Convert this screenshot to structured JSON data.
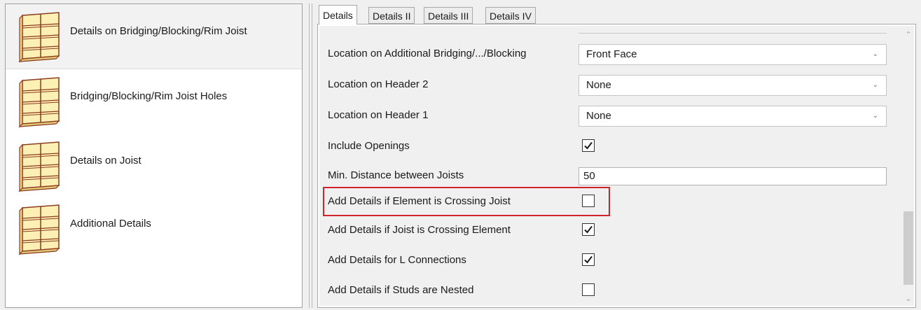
{
  "categories": [
    {
      "label": "Details on Bridging/Blocking/Rim Joist",
      "icon": "joist-frame-icon",
      "selected": true
    },
    {
      "label": "Bridging/Blocking/Rim Joist Holes",
      "icon": "joist-frame-icon",
      "selected": false
    },
    {
      "label": "Details on Joist",
      "icon": "joist-frame-icon",
      "selected": false
    },
    {
      "label": "Additional Details",
      "icon": "joist-frame-icon",
      "selected": false
    }
  ],
  "tabs": [
    {
      "label": "Details",
      "active": true
    },
    {
      "label": "Details II",
      "active": false
    },
    {
      "label": "Details III",
      "active": false
    },
    {
      "label": "Details IV",
      "active": false
    }
  ],
  "properties": [
    {
      "label": "Location on Additional Bridging/.../Blocking",
      "type": "combo",
      "value": "Front Face"
    },
    {
      "label": "Location on Header 2",
      "type": "combo",
      "value": "None"
    },
    {
      "label": "Location on Header 1",
      "type": "combo",
      "value": "None"
    },
    {
      "label": "Include Openings",
      "type": "checkbox",
      "checked": true
    },
    {
      "label": "Min. Distance between Joists",
      "type": "text",
      "value": "50"
    },
    {
      "label": "Add Details if Element is Crossing Joist",
      "type": "checkbox",
      "checked": false,
      "highlighted": true
    },
    {
      "label": "Add Details if Joist is Crossing Element",
      "type": "checkbox",
      "checked": true
    },
    {
      "label": "Add Details for L Connections",
      "type": "checkbox",
      "checked": true
    },
    {
      "label": "Add Details if Studs are Nested",
      "type": "checkbox",
      "checked": false
    }
  ],
  "colors": {
    "highlight": "#d2232a",
    "icon_wood": "#fdf0b4",
    "icon_edge": "#8b3a1e"
  },
  "icons": {
    "combo_arrow": "chevron-down-icon",
    "scroll_up": "chevron-up-icon",
    "scroll_down": "chevron-down-icon"
  }
}
